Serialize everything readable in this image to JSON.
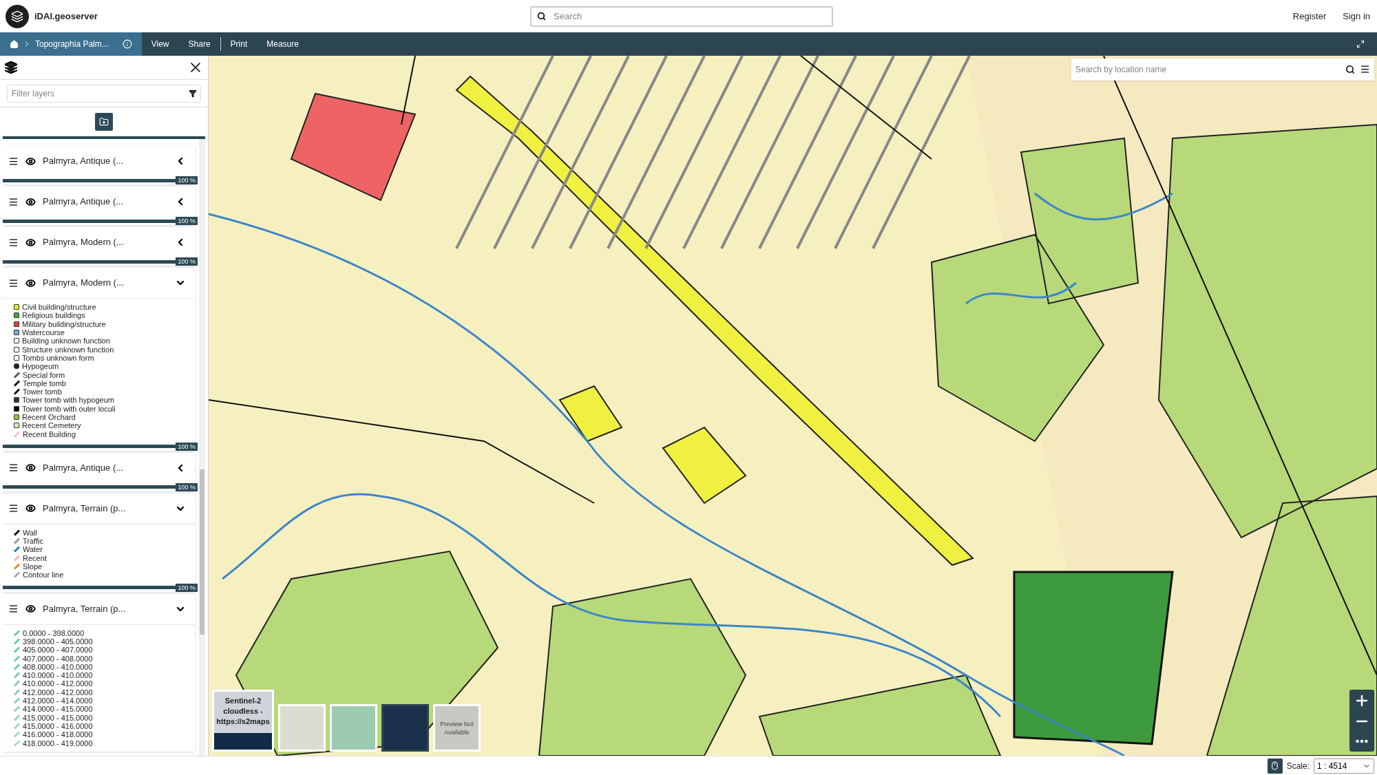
{
  "header": {
    "brand": "iDAI.geoserver",
    "search": {
      "placeholder": "Search"
    },
    "links": [
      "Register",
      "Sign in"
    ]
  },
  "toolbar": {
    "breadcrumb": "Topographia Palm...",
    "items": [
      "View",
      "Share",
      "Print",
      "Measure"
    ]
  },
  "sidebar": {
    "filter": {
      "placeholder": "Filter layers"
    },
    "layers": [
      {
        "name": "Palmyra, Antique (...",
        "expanded": false,
        "level": 1,
        "opacity": "100 %"
      },
      {
        "name": "Palmyra, Antique (...",
        "expanded": false,
        "level": 1,
        "opacity": "100 %"
      },
      {
        "name": "Palmyra, Modern (...",
        "expanded": false,
        "level": 1,
        "opacity": "100 %"
      },
      {
        "name": "Palmyra, Modern (...",
        "expanded": true,
        "level": 1,
        "opacity": "100 %",
        "legend": [
          {
            "label": "Civil building/structure",
            "kind": "square",
            "color": "#e8e82a"
          },
          {
            "label": "Religious buildings",
            "kind": "square",
            "color": "#3fa845"
          },
          {
            "label": "Military building/structure",
            "kind": "square",
            "color": "#e04444"
          },
          {
            "label": "Watercourse",
            "kind": "square",
            "color": "#7aa8d8"
          },
          {
            "label": "Building unknown function",
            "kind": "square",
            "color": "#ffffff"
          },
          {
            "label": "Structure unknown function",
            "kind": "square",
            "color": "#ffffff"
          },
          {
            "label": "Tombs unknown form",
            "kind": "square",
            "color": "#ffffff"
          },
          {
            "label": "Hypogeum",
            "kind": "dot",
            "color": "#222222"
          },
          {
            "label": "Special form",
            "kind": "line",
            "color": "#555555"
          },
          {
            "label": "Temple tomb",
            "kind": "line",
            "color": "#111111"
          },
          {
            "label": "Tower tomb",
            "kind": "line",
            "color": "#111111"
          },
          {
            "label": "Tower tomb with hypogeum",
            "kind": "square",
            "color": "#333333"
          },
          {
            "label": "Tower tomb with outer loculi",
            "kind": "square",
            "color": "#000000"
          },
          {
            "label": "Recent Orchard",
            "kind": "square",
            "color": "#8cc63f"
          },
          {
            "label": "Recent Cemetery",
            "kind": "square",
            "color": "#dcebb4"
          },
          {
            "label": "Recent Building",
            "kind": "line",
            "color": "#f2c4b4"
          }
        ]
      },
      {
        "name": "Palmyra, Antique (...",
        "expanded": false,
        "level": 1,
        "opacity": "100 %"
      },
      {
        "name": "Palmyra, Terrain (p...",
        "expanded": true,
        "level": 1,
        "opacity": "100 %",
        "legend": [
          {
            "label": "Wall",
            "kind": "line",
            "color": "#111111"
          },
          {
            "label": "Traffic",
            "kind": "line",
            "color": "#999999"
          },
          {
            "label": "Water",
            "kind": "line",
            "color": "#2a78c8"
          },
          {
            "label": "Recent",
            "kind": "line",
            "color": "#f2b8a8"
          },
          {
            "label": "Slope",
            "kind": "line",
            "color": "#e8881e"
          },
          {
            "label": "Contour line",
            "kind": "line",
            "color": "#aaaaaa"
          }
        ]
      },
      {
        "name": "Palmyra, Terrain (p...",
        "expanded": true,
        "legend": [
          {
            "label": "0.0000 - 398.0000",
            "kind": "line",
            "color": "#6cc4b0"
          },
          {
            "label": "398.0000 - 405.0000",
            "kind": "line",
            "color": "#6cc4b0"
          },
          {
            "label": "405.0000 - 407.0000",
            "kind": "line",
            "color": "#6cc4b0"
          },
          {
            "label": "407.0000 - 408.0000",
            "kind": "line",
            "color": "#74c8b4"
          },
          {
            "label": "408.0000 - 410.0000",
            "kind": "line",
            "color": "#74c8b4"
          },
          {
            "label": "410.0000 - 410.0000",
            "kind": "line",
            "color": "#7ccbb8"
          },
          {
            "label": "410.0000 - 412.0000",
            "kind": "line",
            "color": "#7ccbb8"
          },
          {
            "label": "412.0000 - 412.0000",
            "kind": "line",
            "color": "#86d0bd"
          },
          {
            "label": "412.0000 - 414.0000",
            "kind": "line",
            "color": "#86d0bd"
          },
          {
            "label": "414.0000 - 415.0000",
            "kind": "line",
            "color": "#90d4c2"
          },
          {
            "label": "415.0000 - 415.0000",
            "kind": "line",
            "color": "#90d4c2"
          },
          {
            "label": "415.0000 - 416.0000",
            "kind": "line",
            "color": "#9ad8c8"
          },
          {
            "label": "416.0000 - 418.0000",
            "kind": "line",
            "color": "#9ad8c8"
          },
          {
            "label": "418.0000 - 419.0000",
            "kind": "line",
            "color": "#a4dccd"
          }
        ]
      }
    ]
  },
  "map": {
    "search": {
      "placeholder": "Search by location name"
    },
    "basemaps": [
      {
        "kind": "current",
        "label": "Sentinel-2 cloudless - https://s2maps",
        "selected": false
      },
      {
        "kind": "image",
        "selected": false
      },
      {
        "kind": "image",
        "selected": false
      },
      {
        "kind": "image",
        "selected": true
      },
      {
        "kind": "text",
        "label": "Preview Not Available",
        "selected": false
      }
    ]
  },
  "status_bar": {
    "scale_label": "Scale:",
    "scale": "1 : 4514"
  }
}
